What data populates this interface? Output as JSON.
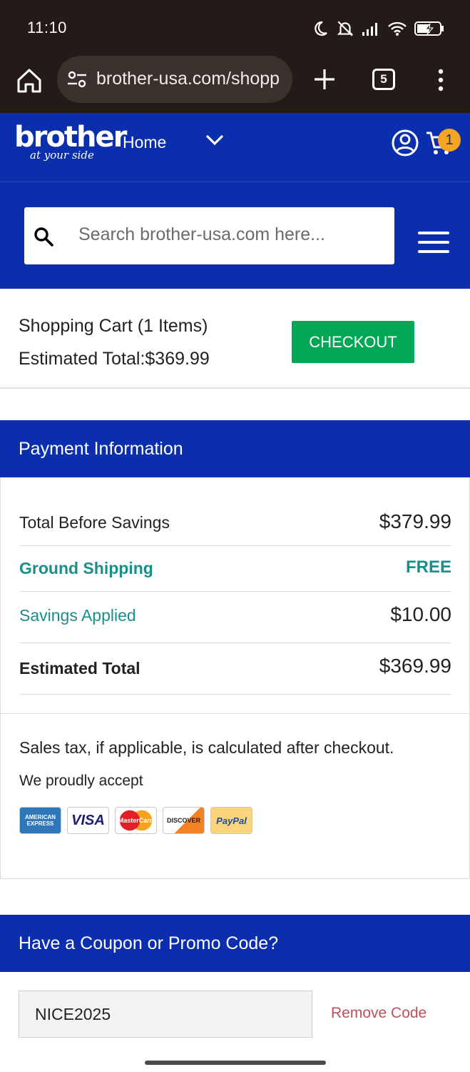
{
  "status_bar": {
    "time": "11:10",
    "icons": [
      "moon-icon",
      "muted-bell-icon",
      "signal-icon",
      "wifi-icon",
      "battery-charging-icon"
    ]
  },
  "browser": {
    "url": "brother-usa.com/shopp",
    "tab_count": "5",
    "icons": [
      "home-icon",
      "site-settings-icon",
      "new-tab-icon",
      "tabs-icon",
      "more-menu-icon"
    ]
  },
  "header": {
    "logo_brand": "brother",
    "logo_tagline": "at your side",
    "home_link": "Home",
    "cart_count": "1",
    "search_placeholder": "Search brother-usa.com here...",
    "brand_color": "#0b2eac"
  },
  "cart_summary": {
    "title": "Shopping Cart (1 Items)",
    "estimated_total": "Estimated Total:$369.99",
    "checkout_label": "CHECKOUT",
    "checkout_color": "#02a755"
  },
  "payment": {
    "heading": "Payment Information",
    "rows": [
      {
        "label": "Total Before Savings",
        "value": "$379.99"
      },
      {
        "label": "Ground Shipping",
        "value": "FREE"
      },
      {
        "label": "Savings Applied",
        "value": "$10.00"
      },
      {
        "label": "Estimated Total",
        "value": "$369.99"
      }
    ],
    "tax_note": "Sales tax, if applicable, is calculated after checkout.",
    "accept_label": "We proudly accept",
    "cards": [
      {
        "name": "amex-logo",
        "text": "AMERICAN EXPRESS"
      },
      {
        "name": "visa-logo",
        "text": "VISA"
      },
      {
        "name": "mastercard-logo",
        "text": "MasterCard"
      },
      {
        "name": "discover-logo",
        "text": "DISCOVER"
      },
      {
        "name": "paypal-logo",
        "text": "PayPal"
      }
    ]
  },
  "coupon": {
    "heading": "Have a Coupon or Promo Code?",
    "code_value": "NICE2025",
    "remove_label": "Remove Code"
  }
}
